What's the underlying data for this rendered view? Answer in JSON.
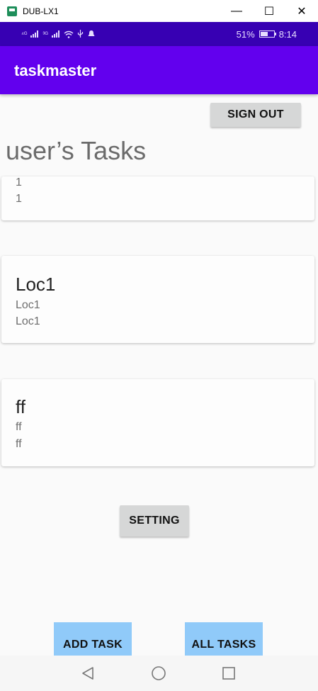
{
  "window": {
    "title": "DUB-LX1",
    "minimize_glyph": "—",
    "maximize_glyph": "☐",
    "close_glyph": "✕"
  },
  "status_bar": {
    "network_1": "⁴ᴳ",
    "network_2": "³ᴳ",
    "battery_percent": "51%",
    "time": "8:14"
  },
  "app_bar": {
    "title": "taskmaster"
  },
  "buttons": {
    "sign_out": "SIGN OUT",
    "setting": "SETTING",
    "add_task": "ADD TASK",
    "all_tasks": "ALL TASKS"
  },
  "heading": "user’s Tasks",
  "tasks": [
    {
      "title": "",
      "line1": "1",
      "line2": "1"
    },
    {
      "title": "Loc1",
      "line1": "Loc1",
      "line2": "Loc1"
    },
    {
      "title": "ff",
      "line1": "ff",
      "line2": "ff"
    }
  ],
  "colors": {
    "status_bar": "#3700b3",
    "app_bar": "#6200ee",
    "button_gray": "#d6d7d7",
    "button_blue": "#90caf9"
  }
}
